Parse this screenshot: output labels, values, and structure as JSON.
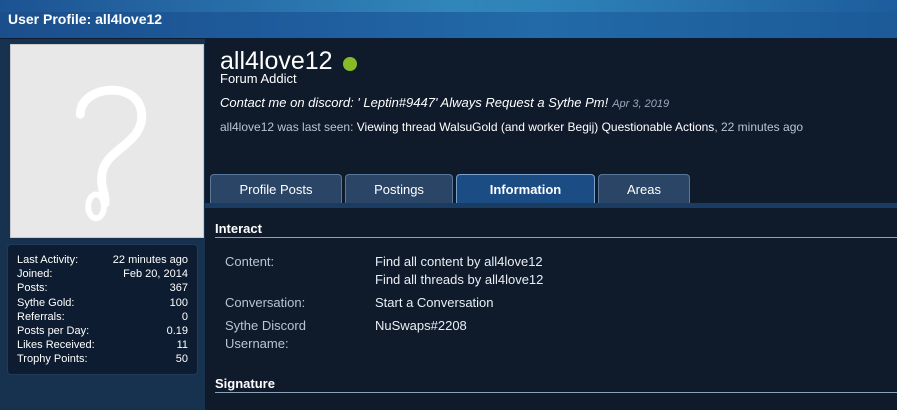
{
  "window": {
    "title": "User Profile: all4love12"
  },
  "profile": {
    "username": "all4love12",
    "user_title": "Forum Addict",
    "status_message": "Contact me on discord: ' Leptin#9447' Always Request a Sythe Pm!",
    "status_date": "Apr 3, 2019",
    "last_seen_prefix": "all4love12 was last seen:",
    "last_seen_activity": "Viewing thread",
    "last_seen_thread": "WalsuGold (and worker Begij) Questionable Actions",
    "last_seen_time": ", 22 minutes ago",
    "online_color": "#86bb27"
  },
  "stats": [
    {
      "label": "Last Activity:",
      "value": "22 minutes ago"
    },
    {
      "label": "Joined:",
      "value": "Feb 20, 2014"
    },
    {
      "label": "Posts:",
      "value": "367"
    },
    {
      "label": "Sythe Gold:",
      "value": "100"
    },
    {
      "label": "Referrals:",
      "value": "0"
    },
    {
      "label": "Posts per Day:",
      "value": "0.19"
    },
    {
      "label": "Likes Received:",
      "value": "11"
    },
    {
      "label": "Trophy Points:",
      "value": "50"
    }
  ],
  "tabs": [
    {
      "label": "Profile Posts"
    },
    {
      "label": "Postings"
    },
    {
      "label": "Information",
      "active": true
    },
    {
      "label": "Areas"
    }
  ],
  "interact": {
    "header": "Interact",
    "content_label": "Content:",
    "find_content": "Find all content by all4love12",
    "find_threads": "Find all threads by all4love12",
    "conversation_label": "Conversation:",
    "start_conversation": "Start a Conversation",
    "discord_label_1": "Sythe Discord",
    "discord_label_2": "Username:",
    "discord_value": "NuSwaps#2208"
  },
  "signature": {
    "header": "Signature"
  }
}
